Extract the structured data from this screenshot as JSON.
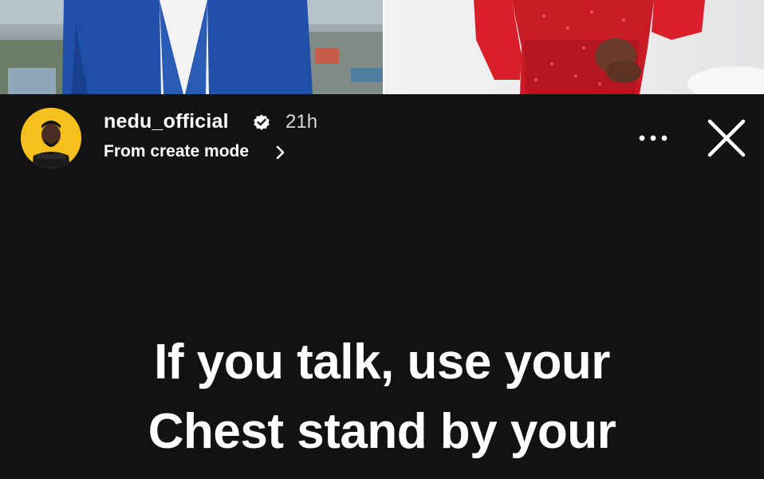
{
  "story": {
    "username": "nedu_official",
    "timestamp": "21h",
    "subtitle": "From create mode",
    "text_lines": [
      "If you talk, use your",
      "Chest stand by your"
    ]
  },
  "colors": {
    "background": "#121212",
    "avatar_ring": "#f5c01d",
    "text": "#ffffff"
  },
  "icons": {
    "verified": "verified-badge-icon",
    "chevron": "chevron-right-icon",
    "more": "more-options-icon",
    "close": "close-icon"
  }
}
